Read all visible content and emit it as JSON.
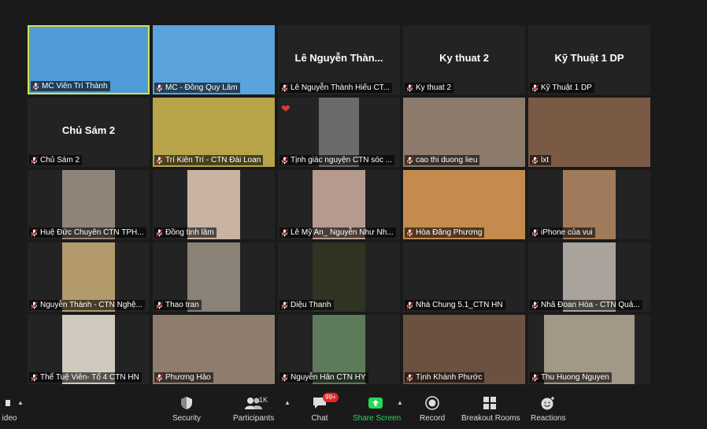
{
  "tiles": [
    {
      "name": "MC Viên Trí Thành",
      "bigname": "",
      "bg": "#4f9bd6",
      "active": true,
      "pin": true
    },
    {
      "name": "MC - Đông Quy Lâm",
      "bigname": "",
      "bg": "#5aa3dc",
      "pin": true
    },
    {
      "name": "Lê Nguyễn Thành Hiếu CT...",
      "bigname": "Lê Nguyễn Thàn..."
    },
    {
      "name": "Ky thuat 2",
      "bigname": "Ky thuat 2"
    },
    {
      "name": "Kỹ Thuật 1 DP",
      "bigname": "Kỹ Thuật 1 DP"
    },
    {
      "name": "Chủ Sám 2",
      "bigname": "Chủ Sám 2"
    },
    {
      "name": "Trí Kiên Trí - CTN Đài Loan",
      "bg": "#b7a44a"
    },
    {
      "name": "Tịnh giác nguyện CTN sóc ...",
      "bg": "#6b6b6b",
      "heart": "❤"
    },
    {
      "name": "cao thi duong lieu",
      "bg": "#8c7a6a"
    },
    {
      "name": "lxt",
      "bg": "#7a5a44"
    },
    {
      "name": "Huệ Đức Chuyên CTN TPH...",
      "bg": "#8f8478"
    },
    {
      "name": "Đồng tịnh lâm",
      "bg": "#c9b3a3"
    },
    {
      "name": "Lê Mỹ An_ Nguyễn Như Nh...",
      "bg": "#b69a8e"
    },
    {
      "name": "Hòa Đăng Phương",
      "bg": "#c58b4e"
    },
    {
      "name": "iPhone của vui",
      "bg": "#a07a5a"
    },
    {
      "name": "Nguyễn Thành - CTN Nghệ...",
      "bg": "#b39a6c"
    },
    {
      "name": "Thao tran",
      "bg": "#8a8277"
    },
    {
      "name": "Diệu Thanh",
      "bg": "#2e3322"
    },
    {
      "name": "Nhà Chung 5.1_CTN HN",
      "bigname": ""
    },
    {
      "name": "Nhã Đoan Hòa - CTN Quả...",
      "bg": "#a9a39b"
    },
    {
      "name": "Thể Tuệ Viên- Tổ 4 CTN HN",
      "bg": "#cfcabd"
    },
    {
      "name": "Phương Hảo",
      "bg": "#8e7c6d"
    },
    {
      "name": "Nguyễn Hân CTN HY",
      "bg": "#5d7a5a"
    },
    {
      "name": "Tịnh Khánh Phước",
      "bg": "#6c5040"
    },
    {
      "name": "Thu Huong Nguyen",
      "bg": "#a29888"
    }
  ],
  "toolbar": {
    "video_label": "ideo",
    "security": "Security",
    "participants": "Participants",
    "participants_count": "1K",
    "chat": "Chat",
    "chat_badge": "99+",
    "share": "Share Screen",
    "record": "Record",
    "breakout": "Breakout Rooms",
    "reactions": "Reactions",
    "share_color": "#23d959"
  }
}
